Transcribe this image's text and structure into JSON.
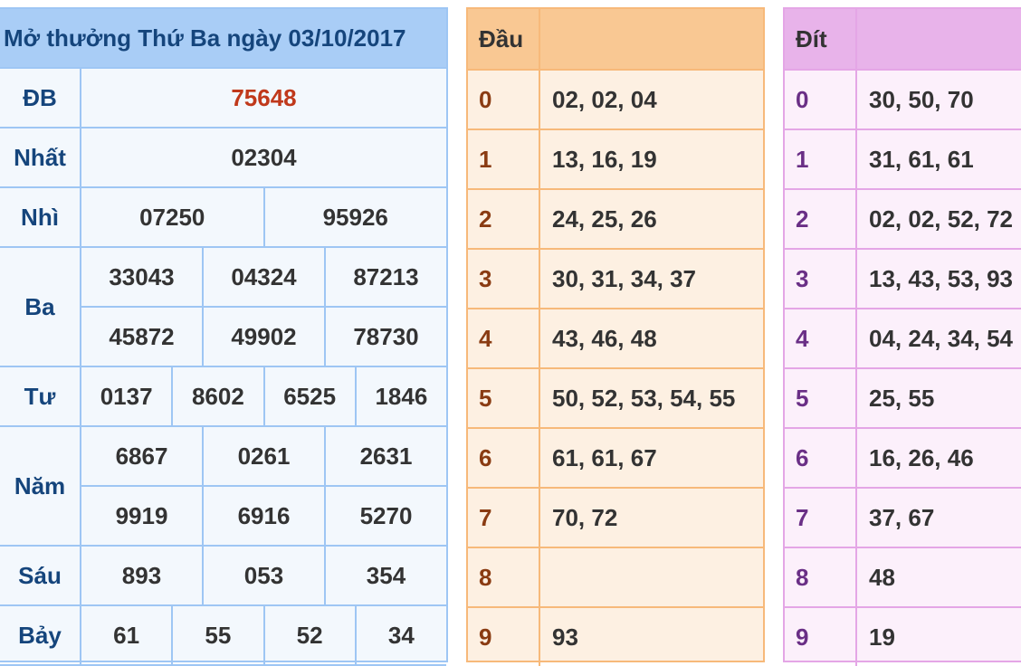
{
  "results": {
    "title": "Mở thưởng Thứ Ba ngày 03/10/2017",
    "prizes": [
      {
        "label": "ĐB",
        "lines": [
          [
            "75648"
          ]
        ]
      },
      {
        "label": "Nhất",
        "lines": [
          [
            "02304"
          ]
        ]
      },
      {
        "label": "Nhì",
        "lines": [
          [
            "07250",
            "95926"
          ]
        ]
      },
      {
        "label": "Ba",
        "lines": [
          [
            "33043",
            "04324",
            "87213"
          ],
          [
            "45872",
            "49902",
            "78730"
          ]
        ]
      },
      {
        "label": "Tư",
        "lines": [
          [
            "0137",
            "8602",
            "6525",
            "1846"
          ]
        ]
      },
      {
        "label": "Năm",
        "lines": [
          [
            "6867",
            "0261",
            "2631"
          ],
          [
            "9919",
            "6916",
            "5270"
          ]
        ]
      },
      {
        "label": "Sáu",
        "lines": [
          [
            "893",
            "053",
            "354"
          ]
        ]
      },
      {
        "label": "Bảy",
        "lines": [
          [
            "61",
            "55",
            "52",
            "34"
          ]
        ]
      }
    ]
  },
  "dau": {
    "header": "Đầu",
    "rows": [
      {
        "key": "0",
        "value": "02, 02, 04"
      },
      {
        "key": "1",
        "value": "13, 16, 19"
      },
      {
        "key": "2",
        "value": "24, 25, 26"
      },
      {
        "key": "3",
        "value": "30, 31, 34, 37"
      },
      {
        "key": "4",
        "value": "43, 46, 48"
      },
      {
        "key": "5",
        "value": "50, 52, 53, 54, 55"
      },
      {
        "key": "6",
        "value": "61, 61, 67"
      },
      {
        "key": "7",
        "value": "70, 72"
      },
      {
        "key": "8",
        "value": ""
      },
      {
        "key": "9",
        "value": "93"
      }
    ]
  },
  "dit": {
    "header": "Đít",
    "rows": [
      {
        "key": "0",
        "value": "30, 50, 70"
      },
      {
        "key": "1",
        "value": "31, 61, 61"
      },
      {
        "key": "2",
        "value": "02, 02, 52, 72"
      },
      {
        "key": "3",
        "value": "13, 43, 53, 93"
      },
      {
        "key": "4",
        "value": "04, 24, 34, 54"
      },
      {
        "key": "5",
        "value": "25, 55"
      },
      {
        "key": "6",
        "value": "16, 26, 46"
      },
      {
        "key": "7",
        "value": "37, 67"
      },
      {
        "key": "8",
        "value": "48"
      },
      {
        "key": "9",
        "value": "19"
      }
    ]
  },
  "colors": {
    "results_border": "#9ec6f4",
    "results_header_bg": "#a9cdf6",
    "dau_border": "#f7b97a",
    "dau_header_bg": "#f9c893",
    "dit_border": "#e4a6e6",
    "dit_header_bg": "#e8b3ea",
    "special_prize": "#c0391b"
  }
}
